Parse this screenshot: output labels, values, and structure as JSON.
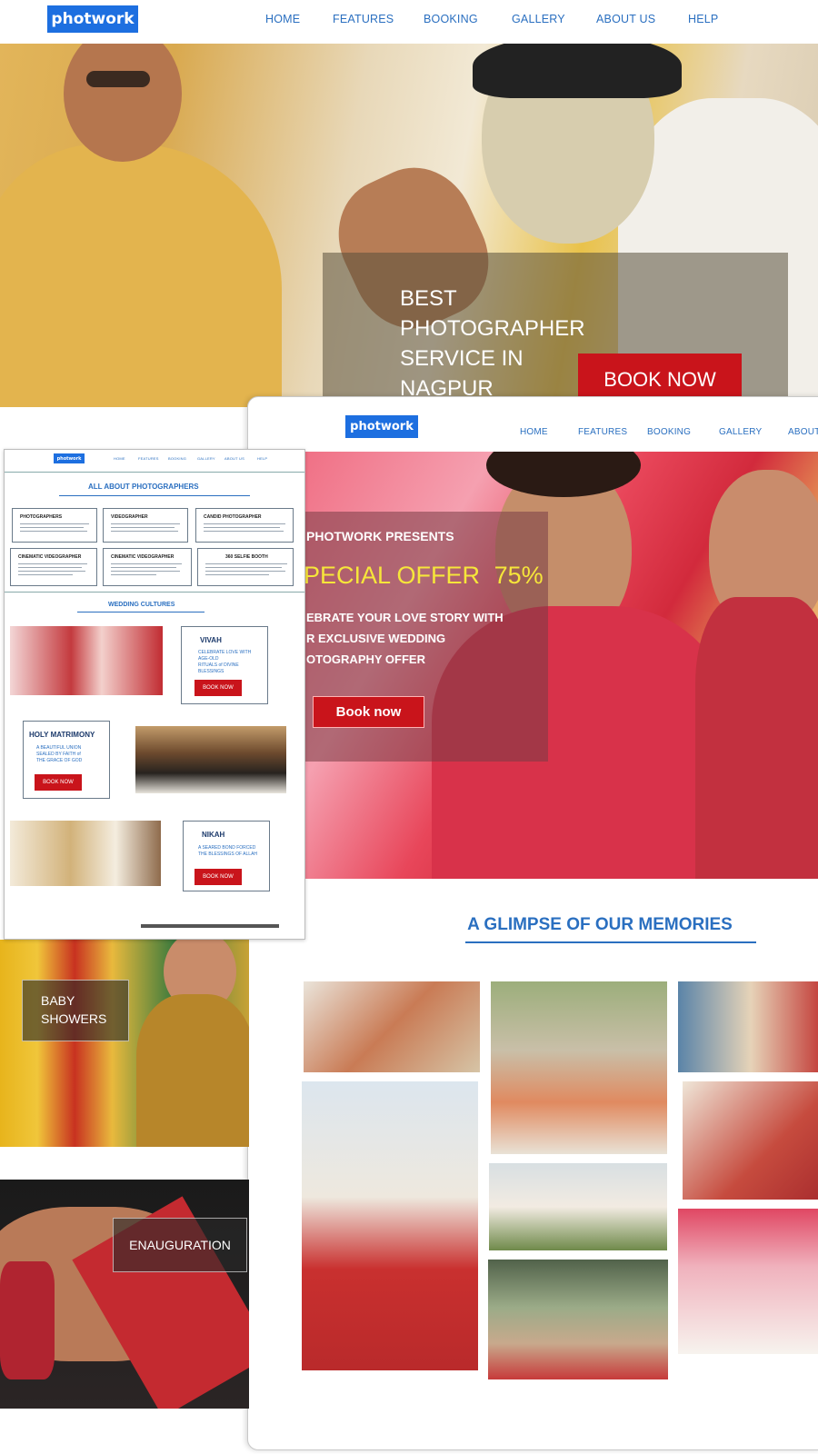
{
  "page1": {
    "logo": "photwork",
    "nav": [
      "HOME",
      "FEATURES",
      "BOOKING",
      "GALLERY",
      "ABOUT US",
      "HELP"
    ],
    "hero_title": [
      "BEST",
      "PHOTOGRAPHER",
      "SERVICE IN",
      "NAGPUR"
    ],
    "book_button": "BOOK NOW"
  },
  "page2": {
    "logo": "photwork",
    "nav": [
      "HOME",
      "FEATURES",
      "BOOKING",
      "GALLERY",
      "ABOUT"
    ],
    "presents": "PHOTWORK PRESENTS",
    "offer": "PECIAL OFFER",
    "offer_pct": "75%",
    "offer_text": [
      "EBRATE YOUR LOVE STORY WITH",
      "R EXCLUSIVE WEDDING",
      "OTOGRAPHY OFFER"
    ],
    "book_button": "Book now",
    "gallery_title": "A GLIMPSE OF OUR MEMORIES"
  },
  "page3": {
    "logo": "photwork",
    "nav": [
      "HOME",
      "FEATURES",
      "BOOKING",
      "GALLERY",
      "ABOUT US",
      "HELP"
    ],
    "about_heading": "ALL ABOUT PHOTOGRAPHERS",
    "photographer_types": [
      "PHOTOGRAPHERS",
      "VIDEOGRAPHER",
      "CANDID PHOTOGRAPHER",
      "CINEMATIC VIDEOGRAPHER",
      "CINEMATIC VIDEOGRAPHER",
      "360 SELFIE BOOTH"
    ],
    "cultures_heading": "WEDDING CULTURES",
    "cultures": [
      {
        "title": "VIVAH",
        "text": [
          "CELEBRATE LOVE WITH",
          "AGE-OLD",
          "RITUALS of DIVINE",
          "BLESSINGS"
        ],
        "button": "BOOK NOW"
      },
      {
        "title": "HOLY MATRIMONY",
        "text": [
          "A BEAUTIFUL UNION",
          "SEALED BY FAITH of",
          "THE GRACE OF GOD"
        ],
        "button": "BOOK NOW"
      },
      {
        "title": "NIKAH",
        "text": [
          "A SEARED BOND FORCED",
          "THE BLESSINGS OF ALLAH"
        ],
        "button": "BOOK NOW"
      }
    ]
  },
  "panels": {
    "baby": [
      "BABY",
      "SHOWERS"
    ],
    "enaug": "ENAUGURATION"
  },
  "colors": {
    "brand": "#1d6fe0",
    "nav_text": "#2a6fc0",
    "button_red": "#c9141b",
    "offer_yellow": "#f6e63a"
  }
}
